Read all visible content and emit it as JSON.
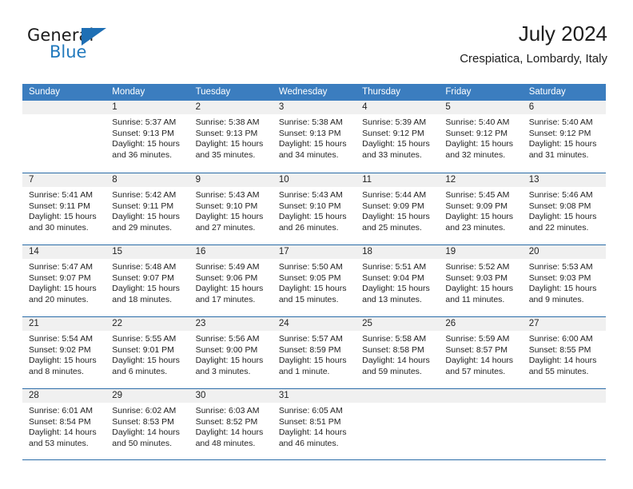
{
  "brand": {
    "word_one": "General",
    "word_two": "Blue",
    "triangle_icon": "triangle-icon",
    "accent_color": "#2179bd",
    "triangle_color": "#1e6fb4"
  },
  "header": {
    "title": "July 2024",
    "location": "Crespiatica, Lombardy, Italy"
  },
  "calendar": {
    "header_bg": "#3b7dbf",
    "row_divider_color": "#2b6ca8",
    "daynum_band_bg": "#f0f0f0",
    "day_names": [
      "Sunday",
      "Monday",
      "Tuesday",
      "Wednesday",
      "Thursday",
      "Friday",
      "Saturday"
    ],
    "weeks": [
      [
        {
          "day": "",
          "sunrise": "",
          "sunset": "",
          "daylight_line1": "",
          "daylight_line2": "",
          "empty": true
        },
        {
          "day": "1",
          "sunrise": "Sunrise: 5:37 AM",
          "sunset": "Sunset: 9:13 PM",
          "daylight_line1": "Daylight: 15 hours",
          "daylight_line2": "and 36 minutes.",
          "empty": false
        },
        {
          "day": "2",
          "sunrise": "Sunrise: 5:38 AM",
          "sunset": "Sunset: 9:13 PM",
          "daylight_line1": "Daylight: 15 hours",
          "daylight_line2": "and 35 minutes.",
          "empty": false
        },
        {
          "day": "3",
          "sunrise": "Sunrise: 5:38 AM",
          "sunset": "Sunset: 9:13 PM",
          "daylight_line1": "Daylight: 15 hours",
          "daylight_line2": "and 34 minutes.",
          "empty": false
        },
        {
          "day": "4",
          "sunrise": "Sunrise: 5:39 AM",
          "sunset": "Sunset: 9:12 PM",
          "daylight_line1": "Daylight: 15 hours",
          "daylight_line2": "and 33 minutes.",
          "empty": false
        },
        {
          "day": "5",
          "sunrise": "Sunrise: 5:40 AM",
          "sunset": "Sunset: 9:12 PM",
          "daylight_line1": "Daylight: 15 hours",
          "daylight_line2": "and 32 minutes.",
          "empty": false
        },
        {
          "day": "6",
          "sunrise": "Sunrise: 5:40 AM",
          "sunset": "Sunset: 9:12 PM",
          "daylight_line1": "Daylight: 15 hours",
          "daylight_line2": "and 31 minutes.",
          "empty": false
        }
      ],
      [
        {
          "day": "7",
          "sunrise": "Sunrise: 5:41 AM",
          "sunset": "Sunset: 9:11 PM",
          "daylight_line1": "Daylight: 15 hours",
          "daylight_line2": "and 30 minutes.",
          "empty": false
        },
        {
          "day": "8",
          "sunrise": "Sunrise: 5:42 AM",
          "sunset": "Sunset: 9:11 PM",
          "daylight_line1": "Daylight: 15 hours",
          "daylight_line2": "and 29 minutes.",
          "empty": false
        },
        {
          "day": "9",
          "sunrise": "Sunrise: 5:43 AM",
          "sunset": "Sunset: 9:10 PM",
          "daylight_line1": "Daylight: 15 hours",
          "daylight_line2": "and 27 minutes.",
          "empty": false
        },
        {
          "day": "10",
          "sunrise": "Sunrise: 5:43 AM",
          "sunset": "Sunset: 9:10 PM",
          "daylight_line1": "Daylight: 15 hours",
          "daylight_line2": "and 26 minutes.",
          "empty": false
        },
        {
          "day": "11",
          "sunrise": "Sunrise: 5:44 AM",
          "sunset": "Sunset: 9:09 PM",
          "daylight_line1": "Daylight: 15 hours",
          "daylight_line2": "and 25 minutes.",
          "empty": false
        },
        {
          "day": "12",
          "sunrise": "Sunrise: 5:45 AM",
          "sunset": "Sunset: 9:09 PM",
          "daylight_line1": "Daylight: 15 hours",
          "daylight_line2": "and 23 minutes.",
          "empty": false
        },
        {
          "day": "13",
          "sunrise": "Sunrise: 5:46 AM",
          "sunset": "Sunset: 9:08 PM",
          "daylight_line1": "Daylight: 15 hours",
          "daylight_line2": "and 22 minutes.",
          "empty": false
        }
      ],
      [
        {
          "day": "14",
          "sunrise": "Sunrise: 5:47 AM",
          "sunset": "Sunset: 9:07 PM",
          "daylight_line1": "Daylight: 15 hours",
          "daylight_line2": "and 20 minutes.",
          "empty": false
        },
        {
          "day": "15",
          "sunrise": "Sunrise: 5:48 AM",
          "sunset": "Sunset: 9:07 PM",
          "daylight_line1": "Daylight: 15 hours",
          "daylight_line2": "and 18 minutes.",
          "empty": false
        },
        {
          "day": "16",
          "sunrise": "Sunrise: 5:49 AM",
          "sunset": "Sunset: 9:06 PM",
          "daylight_line1": "Daylight: 15 hours",
          "daylight_line2": "and 17 minutes.",
          "empty": false
        },
        {
          "day": "17",
          "sunrise": "Sunrise: 5:50 AM",
          "sunset": "Sunset: 9:05 PM",
          "daylight_line1": "Daylight: 15 hours",
          "daylight_line2": "and 15 minutes.",
          "empty": false
        },
        {
          "day": "18",
          "sunrise": "Sunrise: 5:51 AM",
          "sunset": "Sunset: 9:04 PM",
          "daylight_line1": "Daylight: 15 hours",
          "daylight_line2": "and 13 minutes.",
          "empty": false
        },
        {
          "day": "19",
          "sunrise": "Sunrise: 5:52 AM",
          "sunset": "Sunset: 9:03 PM",
          "daylight_line1": "Daylight: 15 hours",
          "daylight_line2": "and 11 minutes.",
          "empty": false
        },
        {
          "day": "20",
          "sunrise": "Sunrise: 5:53 AM",
          "sunset": "Sunset: 9:03 PM",
          "daylight_line1": "Daylight: 15 hours",
          "daylight_line2": "and 9 minutes.",
          "empty": false
        }
      ],
      [
        {
          "day": "21",
          "sunrise": "Sunrise: 5:54 AM",
          "sunset": "Sunset: 9:02 PM",
          "daylight_line1": "Daylight: 15 hours",
          "daylight_line2": "and 8 minutes.",
          "empty": false
        },
        {
          "day": "22",
          "sunrise": "Sunrise: 5:55 AM",
          "sunset": "Sunset: 9:01 PM",
          "daylight_line1": "Daylight: 15 hours",
          "daylight_line2": "and 6 minutes.",
          "empty": false
        },
        {
          "day": "23",
          "sunrise": "Sunrise: 5:56 AM",
          "sunset": "Sunset: 9:00 PM",
          "daylight_line1": "Daylight: 15 hours",
          "daylight_line2": "and 3 minutes.",
          "empty": false
        },
        {
          "day": "24",
          "sunrise": "Sunrise: 5:57 AM",
          "sunset": "Sunset: 8:59 PM",
          "daylight_line1": "Daylight: 15 hours",
          "daylight_line2": "and 1 minute.",
          "empty": false
        },
        {
          "day": "25",
          "sunrise": "Sunrise: 5:58 AM",
          "sunset": "Sunset: 8:58 PM",
          "daylight_line1": "Daylight: 14 hours",
          "daylight_line2": "and 59 minutes.",
          "empty": false
        },
        {
          "day": "26",
          "sunrise": "Sunrise: 5:59 AM",
          "sunset": "Sunset: 8:57 PM",
          "daylight_line1": "Daylight: 14 hours",
          "daylight_line2": "and 57 minutes.",
          "empty": false
        },
        {
          "day": "27",
          "sunrise": "Sunrise: 6:00 AM",
          "sunset": "Sunset: 8:55 PM",
          "daylight_line1": "Daylight: 14 hours",
          "daylight_line2": "and 55 minutes.",
          "empty": false
        }
      ],
      [
        {
          "day": "28",
          "sunrise": "Sunrise: 6:01 AM",
          "sunset": "Sunset: 8:54 PM",
          "daylight_line1": "Daylight: 14 hours",
          "daylight_line2": "and 53 minutes.",
          "empty": false
        },
        {
          "day": "29",
          "sunrise": "Sunrise: 6:02 AM",
          "sunset": "Sunset: 8:53 PM",
          "daylight_line1": "Daylight: 14 hours",
          "daylight_line2": "and 50 minutes.",
          "empty": false
        },
        {
          "day": "30",
          "sunrise": "Sunrise: 6:03 AM",
          "sunset": "Sunset: 8:52 PM",
          "daylight_line1": "Daylight: 14 hours",
          "daylight_line2": "and 48 minutes.",
          "empty": false
        },
        {
          "day": "31",
          "sunrise": "Sunrise: 6:05 AM",
          "sunset": "Sunset: 8:51 PM",
          "daylight_line1": "Daylight: 14 hours",
          "daylight_line2": "and 46 minutes.",
          "empty": false
        },
        {
          "day": "",
          "sunrise": "",
          "sunset": "",
          "daylight_line1": "",
          "daylight_line2": "",
          "empty": true
        },
        {
          "day": "",
          "sunrise": "",
          "sunset": "",
          "daylight_line1": "",
          "daylight_line2": "",
          "empty": true
        },
        {
          "day": "",
          "sunrise": "",
          "sunset": "",
          "daylight_line1": "",
          "daylight_line2": "",
          "empty": true
        }
      ]
    ]
  }
}
